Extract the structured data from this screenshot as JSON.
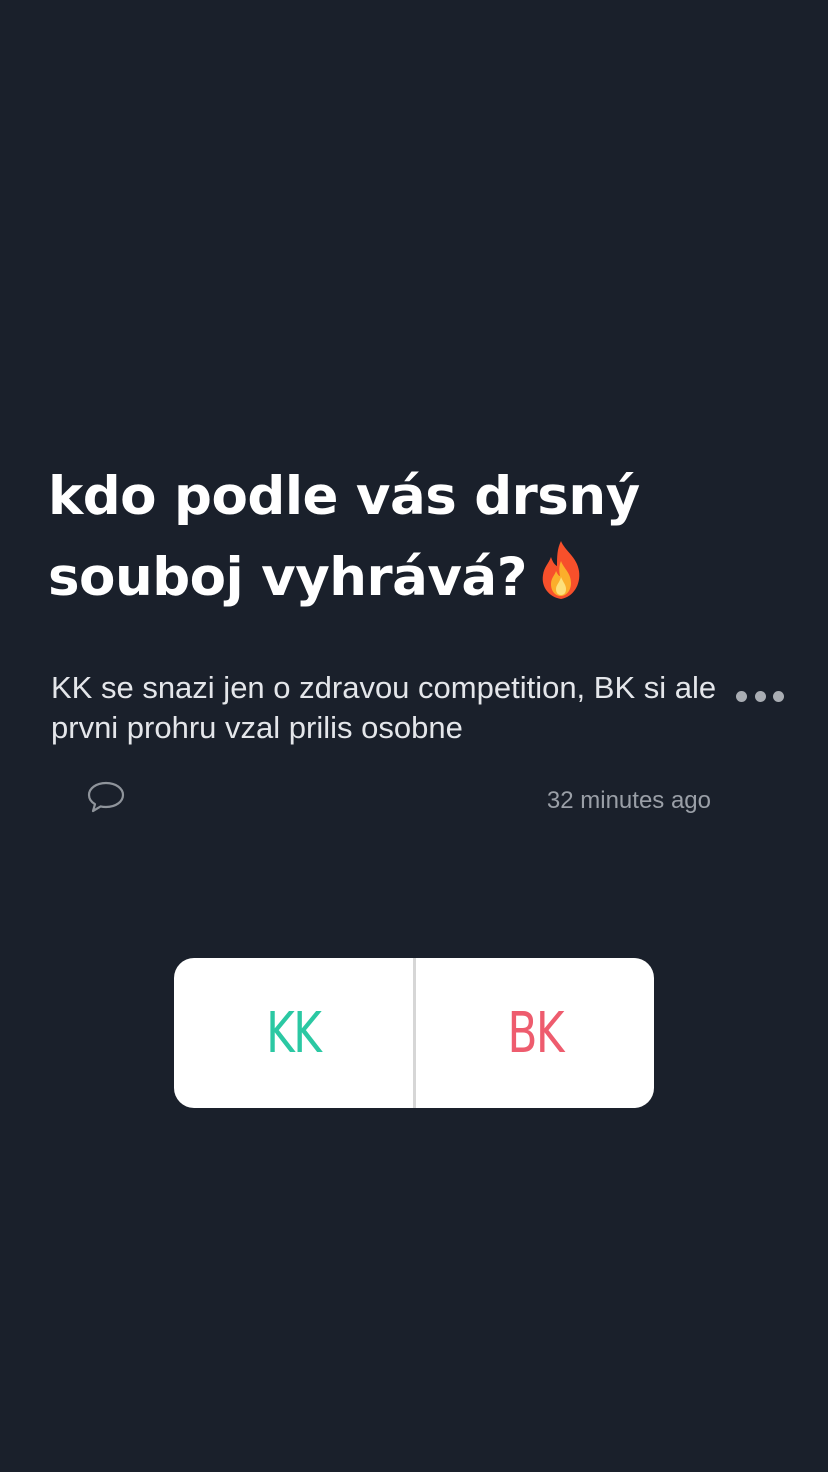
{
  "story": {
    "title": "kdo podle vás drsný souboj vyhrává?",
    "title_emoji": "fire-emoji",
    "caption": "KK se snazi jen o zdravou competition, BK si ale prvni prohru vzal prilis osobne",
    "timestamp": "32 minutes ago"
  },
  "icons": {
    "more": "more-dots-icon",
    "comment": "comment-bubble-icon"
  },
  "poll": {
    "options": [
      {
        "label": "KK",
        "color": "#2bc8a3"
      },
      {
        "label": "BK",
        "color": "#ee5c6e"
      }
    ]
  },
  "colors": {
    "background": "#1a202b",
    "title": "#ffffff",
    "caption": "#e4e6ea",
    "timestamp": "#9a9fa7"
  }
}
